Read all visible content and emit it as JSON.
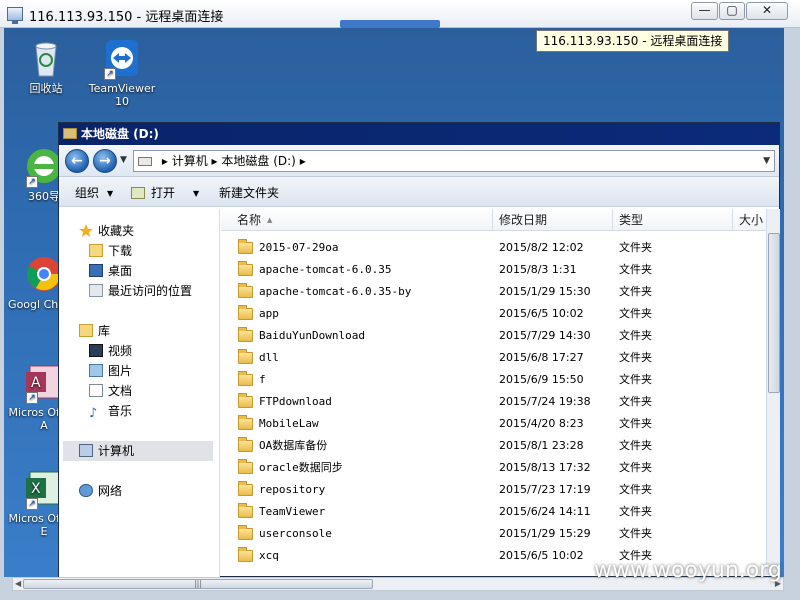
{
  "rdp": {
    "title": "116.113.93.150 - 远程桌面连接",
    "minimize": "—",
    "maximize": "▢",
    "close": "✕",
    "tooltip": "116.113.93.150 - 远程桌面连接"
  },
  "desktop": {
    "icons": [
      {
        "label": "回收站",
        "icon": "recycle-bin-icon"
      },
      {
        "label": "TeamViewer 10",
        "icon": "teamviewer-icon"
      },
      {
        "label": "360导",
        "icon": "360-browser-icon"
      },
      {
        "label": "Googl Chrom",
        "icon": "chrome-icon"
      },
      {
        "label": "Micros Office A",
        "icon": "access-icon"
      },
      {
        "label": "Micros Office E",
        "icon": "excel-icon"
      }
    ]
  },
  "explorer": {
    "title": "本地磁盘 (D:)",
    "address": {
      "crumbs": [
        "计算机",
        "本地磁盘 (D:)"
      ],
      "separator": "▸"
    },
    "toolbar": {
      "organize": "组织",
      "open": "打开",
      "new_folder": "新建文件夹"
    },
    "nav": {
      "favorites": "收藏夹",
      "downloads": "下载",
      "desktop": "桌面",
      "recent": "最近访问的位置",
      "libraries": "库",
      "videos": "视频",
      "pictures": "图片",
      "documents": "文档",
      "music": "音乐",
      "computer": "计算机",
      "network": "网络"
    },
    "columns": {
      "name": "名称",
      "date": "修改日期",
      "type": "类型",
      "size": "大小"
    },
    "files": [
      {
        "name": "2015-07-29oa",
        "date": "2015/8/2 12:02",
        "type": "文件夹"
      },
      {
        "name": "apache-tomcat-6.0.35",
        "date": "2015/8/3 1:31",
        "type": "文件夹"
      },
      {
        "name": "apache-tomcat-6.0.35-by",
        "date": "2015/1/29 15:30",
        "type": "文件夹"
      },
      {
        "name": "app",
        "date": "2015/6/5 10:02",
        "type": "文件夹"
      },
      {
        "name": "BaiduYunDownload",
        "date": "2015/7/29 14:30",
        "type": "文件夹"
      },
      {
        "name": "dll",
        "date": "2015/6/8 17:27",
        "type": "文件夹"
      },
      {
        "name": "f",
        "date": "2015/6/9 15:50",
        "type": "文件夹"
      },
      {
        "name": "FTPdownload",
        "date": "2015/7/24 19:38",
        "type": "文件夹"
      },
      {
        "name": "MobileLaw",
        "date": "2015/4/20 8:23",
        "type": "文件夹"
      },
      {
        "name": "OA数据库备份",
        "date": "2015/8/1 23:28",
        "type": "文件夹"
      },
      {
        "name": "oracle数据同步",
        "date": "2015/8/13 17:32",
        "type": "文件夹"
      },
      {
        "name": "repository",
        "date": "2015/7/23 17:19",
        "type": "文件夹"
      },
      {
        "name": "TeamViewer",
        "date": "2015/6/24 14:11",
        "type": "文件夹"
      },
      {
        "name": "userconsole",
        "date": "2015/1/29 15:29",
        "type": "文件夹"
      },
      {
        "name": "xcq",
        "date": "2015/6/5 10:02",
        "type": "文件夹"
      }
    ]
  },
  "watermark": "www.wooyun.org"
}
